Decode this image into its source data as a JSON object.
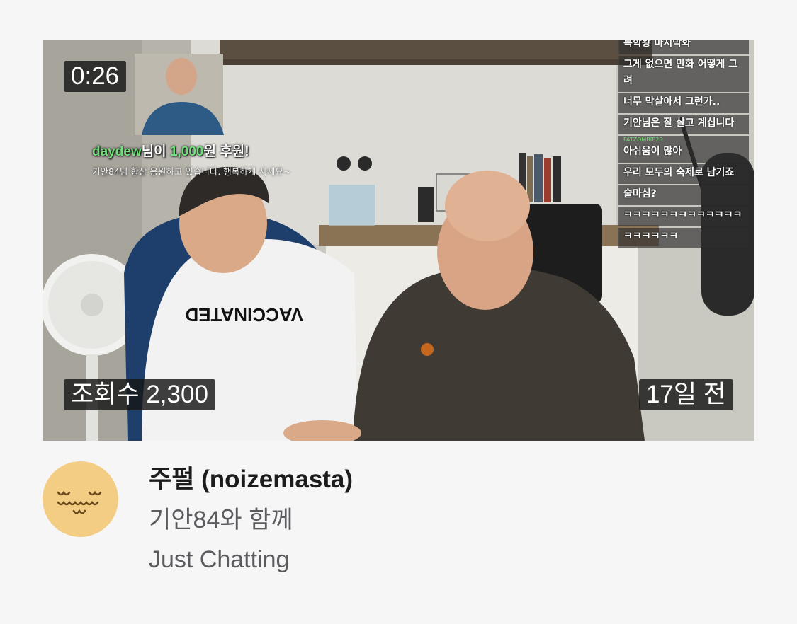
{
  "video": {
    "duration": "0:26",
    "views_label": "조회수 2,300",
    "date_label": "17일 전"
  },
  "donation_overlay": {
    "user": "daydew",
    "text_mid": "님이 ",
    "amount": "1,000",
    "text_end": "원 후원!",
    "message": "기안84님 항상 응원하고 있습니다. 행복하게 사세요~"
  },
  "chat": [
    {
      "user": "",
      "text": "",
      "color": "#ff5b5b"
    },
    {
      "user": "",
      "text": "복학왕 마지막화",
      "color": "#ff5b5b"
    },
    {
      "user": "",
      "text": "그게 없으면 만화 어떻게 그려",
      "color": "#5bd27a"
    },
    {
      "user": "",
      "text": "너무 막살아서 그런가..",
      "color": "#ff6bb5"
    },
    {
      "user": "",
      "text": "기안님은 잘 살고 계십니다",
      "color": "#8ee07a"
    },
    {
      "user": "FATZOMBIE25",
      "text": "아쉬움이 많아",
      "color": "#6adf6a"
    },
    {
      "user": "",
      "text": "우리 모두의 숙제로 남기죠",
      "color": "#9b6bff"
    },
    {
      "user": "",
      "text": "술마심?",
      "color": "#ff5b5b"
    },
    {
      "user": "",
      "text": "ㅋㅋㅋㅋㅋㅋㅋㅋㅋㅋㅋㅋㅋ",
      "color": "#ff9d5b"
    },
    {
      "user": "",
      "text": "ㅋㅋㅋㅋㅋㅋ",
      "color": "#ff5b5b"
    }
  ],
  "channel": {
    "name": "주펄 (noizemasta)",
    "avatar_color": "#f4cd84"
  },
  "title": "기안84와 함께",
  "category": "Just Chatting"
}
